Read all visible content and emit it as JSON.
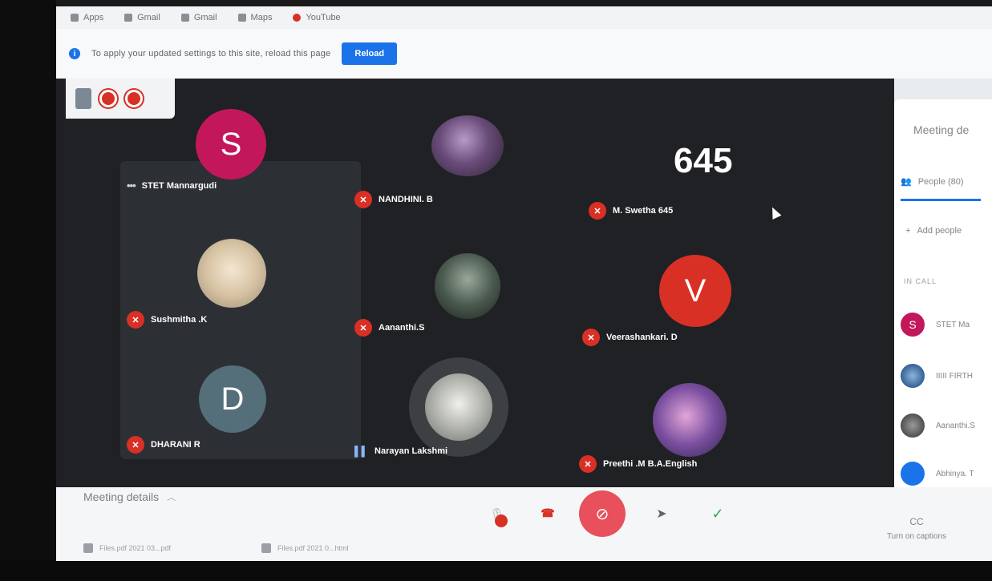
{
  "browser": {
    "bookmarks": [
      {
        "label": "Apps",
        "icon": "apps-icon"
      },
      {
        "label": "Gmail",
        "icon": "gmail-icon"
      },
      {
        "label": "Gmail",
        "icon": "mail-icon"
      },
      {
        "label": "Maps",
        "icon": "maps-icon"
      },
      {
        "label": "YouTube",
        "icon": "youtube-icon"
      }
    ],
    "infobar": {
      "message": "To apply your updated settings to this site, reload this page",
      "reload_label": "Reload"
    }
  },
  "meeting": {
    "participants": [
      {
        "name": "STET Mannargudi",
        "initial": "S",
        "avatar_color": "#c2185b",
        "mic": "dots"
      },
      {
        "name": "NANDHINI. B",
        "initial": "",
        "avatar_color": "#6a4c7a",
        "mic": "muted"
      },
      {
        "name": "M. Swetha 645",
        "initial": "",
        "avatar_color": "#202124",
        "mic": "muted"
      },
      {
        "name": "Sushmitha .K",
        "initial": "",
        "avatar_color": "#e8dccc",
        "mic": "muted"
      },
      {
        "name": "Aananthi.S",
        "initial": "",
        "avatar_color": "#4a5a4e",
        "mic": "muted"
      },
      {
        "name": "Veerashankari. D",
        "initial": "V",
        "avatar_color": "#d93025",
        "mic": "muted"
      },
      {
        "name": "DHARANI R",
        "initial": "D",
        "avatar_color": "#546e7a",
        "mic": "muted"
      },
      {
        "name": "Narayan Lakshmi",
        "initial": "",
        "avatar_color": "#8a8f94",
        "mic": "speaking"
      },
      {
        "name": "Preethi .M B.A.English",
        "initial": "",
        "avatar_color": "#7b4fa0",
        "mic": "muted"
      }
    ],
    "big_number": "645"
  },
  "controls": {
    "meeting_details": "Meeting details",
    "downloads": [
      "Files.pdf 2021 03...pdf",
      "Files.pdf 2021 0...html"
    ],
    "captions_label": "Turn on captions",
    "captions_icon": "CC"
  },
  "side_panel": {
    "title": "Meeting de",
    "people_label": "People (80)",
    "add_people_label": "Add people",
    "in_call_label": "IN CALL",
    "people": [
      {
        "name": "STET Ma",
        "initial": "S",
        "color": "#c2185b"
      },
      {
        "name": "IIIII FIRTH",
        "initial": "",
        "color": "#3f6ea0"
      },
      {
        "name": "Aananthi.S",
        "initial": "",
        "color": "#5a5a5a"
      },
      {
        "name": "Abhinya. T",
        "initial": "",
        "color": "#1a73e8"
      }
    ]
  }
}
